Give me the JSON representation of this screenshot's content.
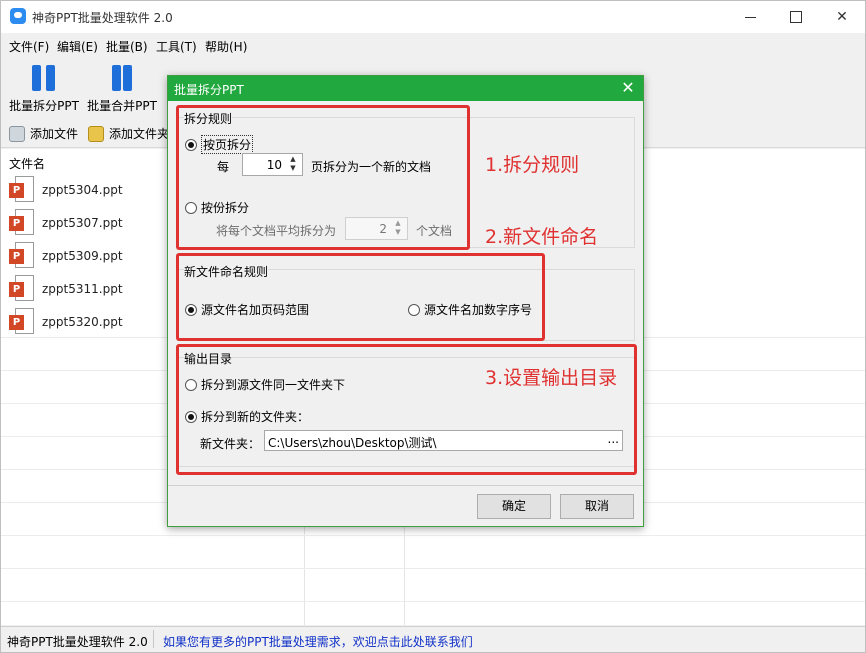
{
  "window": {
    "title": "神奇PPT批量处理软件 2.0",
    "close_glyph": "✕"
  },
  "menu": [
    "文件(F)",
    "编辑(E)",
    "批量(B)",
    "工具(T)",
    "帮助(H)"
  ],
  "toolbar": {
    "split_label": "批量拆分PPT",
    "merge_label": "批量合并PPT"
  },
  "subbar": {
    "add_file": "添加文件",
    "add_folder": "添加文件夹"
  },
  "filelist": {
    "header": "文件名",
    "files": [
      "zppt5304.ppt",
      "zppt5307.ppt",
      "zppt5309.ppt",
      "zppt5311.ppt",
      "zppt5320.ppt"
    ],
    "file_icon_letter": "P"
  },
  "status": {
    "left": "神奇PPT批量处理软件 2.0",
    "link": "如果您有更多的PPT批量处理需求，欢迎点击此处联系我们"
  },
  "dialog": {
    "title": "批量拆分PPT",
    "close_glyph": "✕",
    "split_rule": {
      "label": "拆分规则",
      "by_page": "按页拆分",
      "every": "每",
      "page_count": "10",
      "page_suffix": "页拆分为一个新的文档",
      "by_part": "按份拆分",
      "part_prefix": "将每个文档平均拆分为",
      "part_count": "2",
      "part_suffix": "个文档",
      "selected": "by_page"
    },
    "naming": {
      "label": "新文件命名规则",
      "option_range": "源文件名加页码范围",
      "option_number": "源文件名加数字序号",
      "selected": "option_range"
    },
    "output": {
      "label": "输出目录",
      "same_folder": "拆分到源文件同一文件夹下",
      "new_folder": "拆分到新的文件夹：",
      "folder_label": "新文件夹：",
      "path": "C:\\Users\\zhou\\Desktop\\测试\\",
      "browse": "...",
      "selected": "new_folder"
    },
    "ok": "确定",
    "cancel": "取消"
  },
  "annotations": {
    "note1": "1.拆分规则",
    "note2": "2.新文件命名",
    "note3": "3.设置输出目录",
    "color": "#e03131"
  }
}
